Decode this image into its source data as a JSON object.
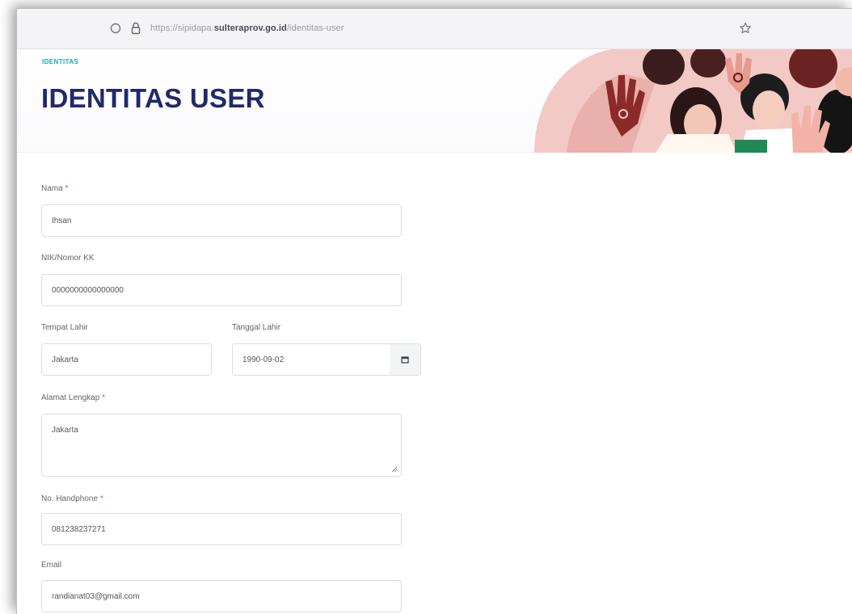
{
  "browser": {
    "url_prefix": "https://sipidapa.",
    "url_host": "sulteraprov.go.id",
    "url_path": "/identitas-user"
  },
  "header": {
    "breadcrumb": "IDENTITAS",
    "title": "IDENTITAS USER"
  },
  "form": {
    "nama": {
      "label": "Nama",
      "required": "*",
      "value": "Ihsan"
    },
    "nik": {
      "label": "NIK/Nomor KK",
      "value": "0000000000000000"
    },
    "tempat_lahir": {
      "label": "Tempat Lahir",
      "value": "Jakarta"
    },
    "tanggal_lahir": {
      "label": "Tanggal Lahir",
      "value": "1990-09-02"
    },
    "alamat": {
      "label": "Alamat Lengkap",
      "required": "*",
      "value": "Jakarta"
    },
    "handphone": {
      "label": "No. Handphone",
      "required": "*",
      "value": "081238237271"
    },
    "email": {
      "label": "Email",
      "value": "randianat03@gmail.com"
    }
  },
  "icons": {
    "shield": "shield-icon",
    "lock": "lock-icon",
    "star": "bookmark-star-icon",
    "calendar": "calendar-icon"
  },
  "colors": {
    "title": "#22286b",
    "breadcrumb": "#1ba6b8",
    "required": "#d9534f"
  }
}
